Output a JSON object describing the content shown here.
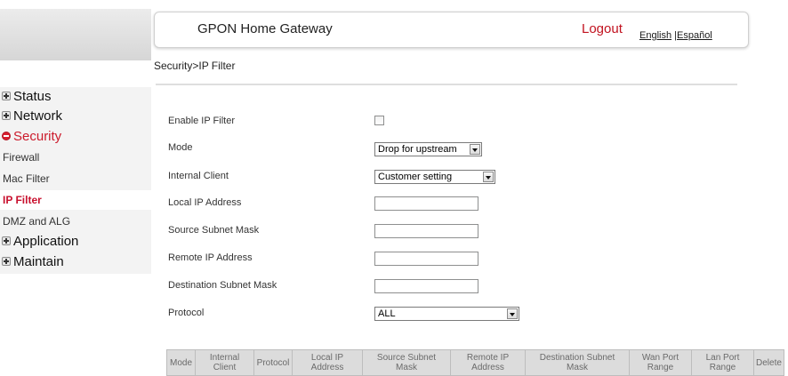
{
  "header": {
    "title": "GPON Home Gateway",
    "logout_label": "Logout",
    "languages": [
      "English",
      "Español"
    ],
    "lang_separator": "|"
  },
  "breadcrumb": "Security>IP Filter",
  "sidebar": {
    "items": [
      {
        "label": "Status",
        "type": "top",
        "expanded": false
      },
      {
        "label": "Network",
        "type": "top",
        "expanded": false
      },
      {
        "label": "Security",
        "type": "top",
        "expanded": true
      },
      {
        "label": "Firewall",
        "type": "sub"
      },
      {
        "label": "Mac Filter",
        "type": "sub"
      },
      {
        "label": "IP Filter",
        "type": "sub",
        "active": true
      },
      {
        "label": "DMZ and ALG",
        "type": "sub"
      },
      {
        "label": "Application",
        "type": "top",
        "expanded": false
      },
      {
        "label": "Maintain",
        "type": "top",
        "expanded": false
      }
    ]
  },
  "form": {
    "enable_ip_filter": {
      "label": "Enable IP Filter",
      "checked": false
    },
    "mode": {
      "label": "Mode",
      "value": "Drop for upstream"
    },
    "internal_client": {
      "label": "Internal Client",
      "value": "Customer setting"
    },
    "local_ip": {
      "label": "Local IP Address",
      "value": ""
    },
    "source_subnet": {
      "label": "Source Subnet Mask",
      "value": ""
    },
    "remote_ip": {
      "label": "Remote IP Address",
      "value": ""
    },
    "dest_subnet": {
      "label": "Destination Subnet Mask",
      "value": ""
    },
    "protocol": {
      "label": "Protocol",
      "value": "ALL"
    }
  },
  "table": {
    "columns": [
      "Mode",
      "Internal\nClient",
      "Protocol",
      "Local IP\nAddress",
      "Source Subnet\nMask",
      "Remote IP\nAddress",
      "Destination Subnet\nMask",
      "Wan Port\nRange",
      "Lan Port\nRange",
      "Delete"
    ],
    "rows": []
  },
  "colors": {
    "accent_red": "#c8102e",
    "sidebar_bg": "#f3f3f3",
    "table_header_bg": "#dcdcdc"
  }
}
